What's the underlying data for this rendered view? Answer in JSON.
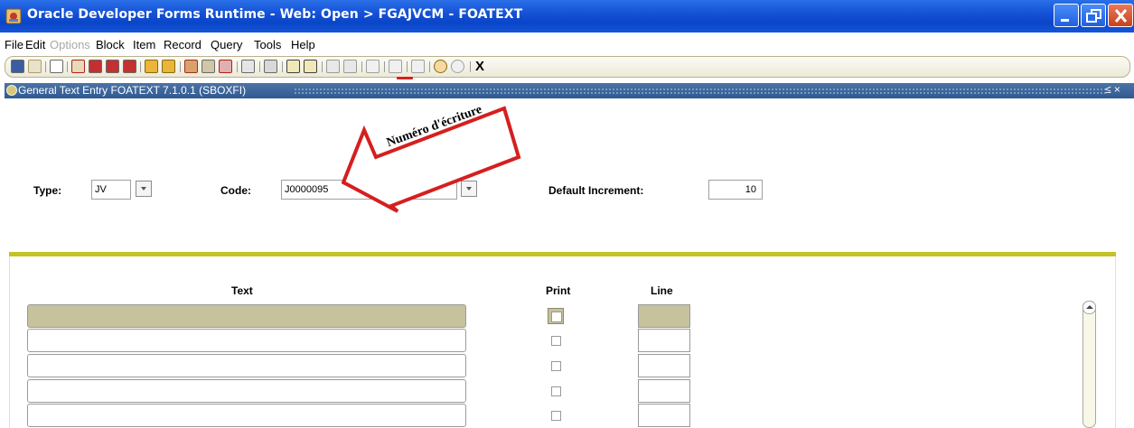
{
  "window": {
    "title": "Oracle Developer Forms Runtime - Web:  Open > FGAJVCM - FOATEXT",
    "icon": "oracle-app-icon"
  },
  "menu": {
    "items": [
      {
        "label": "File",
        "enabled": true
      },
      {
        "label": "Edit",
        "enabled": true
      },
      {
        "label": "Options",
        "enabled": false
      },
      {
        "label": "Block",
        "enabled": true
      },
      {
        "label": "Item",
        "enabled": true
      },
      {
        "label": "Record",
        "enabled": true
      },
      {
        "label": "Query",
        "enabled": true
      },
      {
        "label": "Tools",
        "enabled": true
      },
      {
        "label": "Help",
        "enabled": true
      }
    ]
  },
  "toolbar": {
    "exit_label": "X",
    "icons": [
      "save-icon",
      "rollback-icon",
      "new-document-icon",
      "previous-block-icon",
      "next-block-icon",
      "previous-record-icon",
      "next-record-icon",
      "enter-query-icon",
      "execute-query-icon",
      "insert-record-icon",
      "remove-record-icon",
      "delete-icon",
      "duplicate-icon",
      "print-icon",
      "next-item-icon",
      "previous-item-icon",
      "options-icon",
      "extra-icon",
      "navigate-icon",
      "tree-icon",
      "tools-icon",
      "help-icon",
      "info-icon"
    ]
  },
  "form": {
    "title": "General Text Entry  FOATEXT  7.1.0.1  (SBOXFI)",
    "controls": "≤ ×"
  },
  "key_block": {
    "type_label": "Type:",
    "type_value": "JV",
    "code_label": "Code:",
    "code_value": "J0000095",
    "increment_label": "Default Increment:",
    "increment_value": "10"
  },
  "annotation": {
    "text": "Numéro d'écriture"
  },
  "detail": {
    "headers": {
      "text": "Text",
      "print": "Print",
      "line": "Line"
    },
    "rows": [
      {
        "text": "",
        "print": false,
        "line": "",
        "current": true
      },
      {
        "text": "",
        "print": false,
        "line": "",
        "current": false
      },
      {
        "text": "",
        "print": false,
        "line": "",
        "current": false
      },
      {
        "text": "",
        "print": false,
        "line": "",
        "current": false
      },
      {
        "text": "",
        "print": false,
        "line": "",
        "current": false
      }
    ]
  },
  "colors": {
    "titlebar": "#1552d6",
    "form_titlebar": "#3a6299",
    "block_separator": "#c4c224",
    "current_record": "#c6c29c",
    "annotation_arrow": "#d51f1f"
  }
}
